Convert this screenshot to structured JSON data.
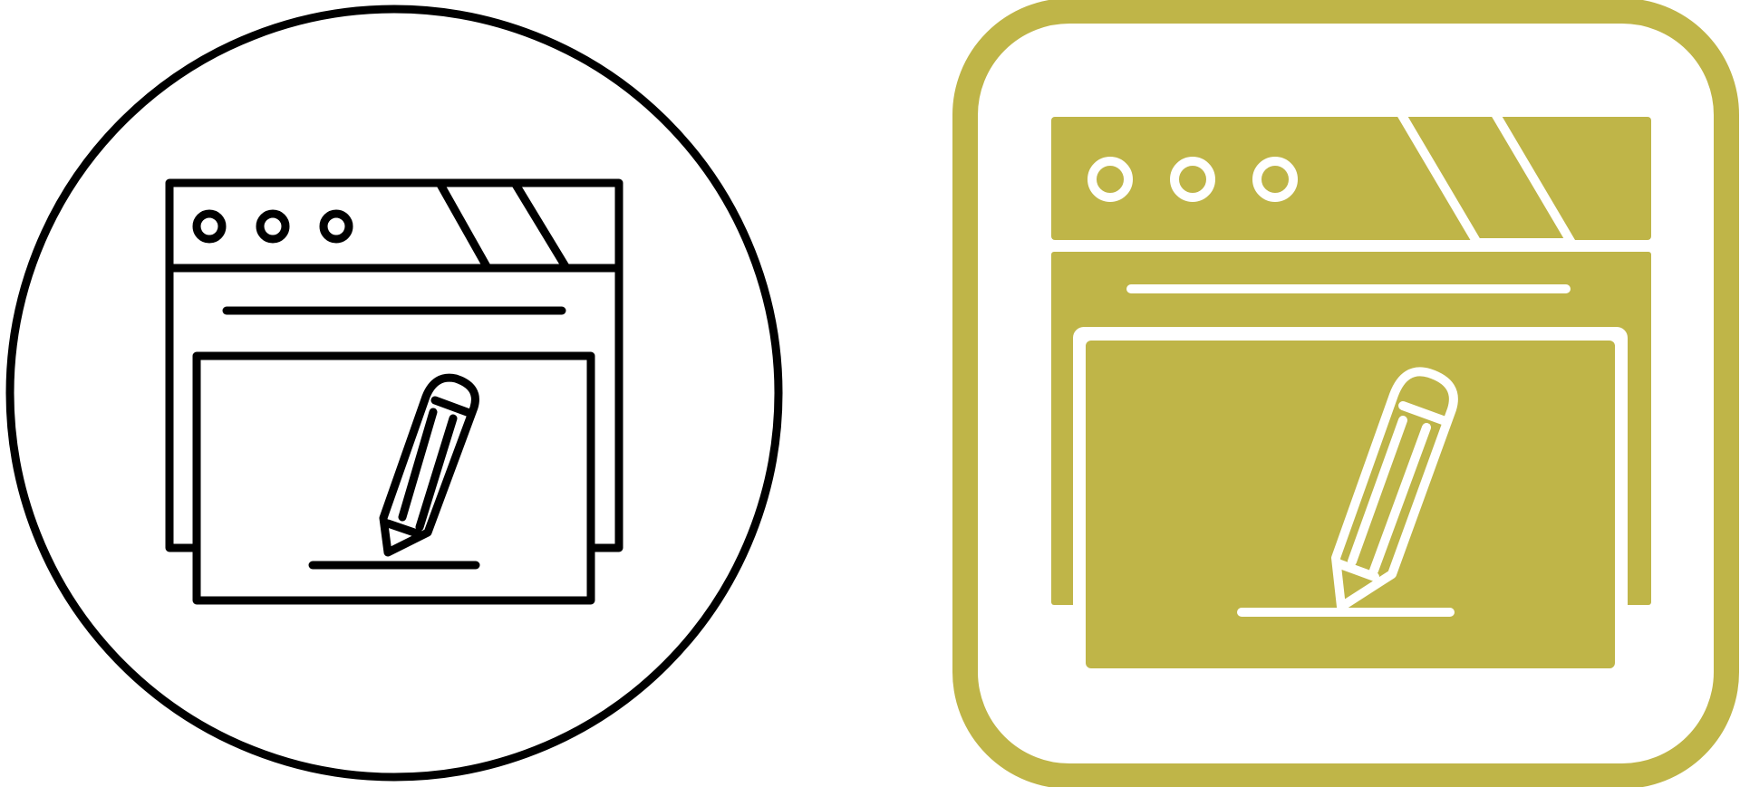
{
  "icons": [
    {
      "style": "outline",
      "frame": "circle",
      "depicts": [
        "browser-window-icon",
        "pencil-icon"
      ],
      "stroke_color": "#000000",
      "background_color": "#ffffff"
    },
    {
      "style": "filled",
      "frame": "rounded-square",
      "depicts": [
        "browser-window-icon",
        "pencil-icon"
      ],
      "accent_color": "#BFB548",
      "line_color": "#ffffff"
    }
  ]
}
